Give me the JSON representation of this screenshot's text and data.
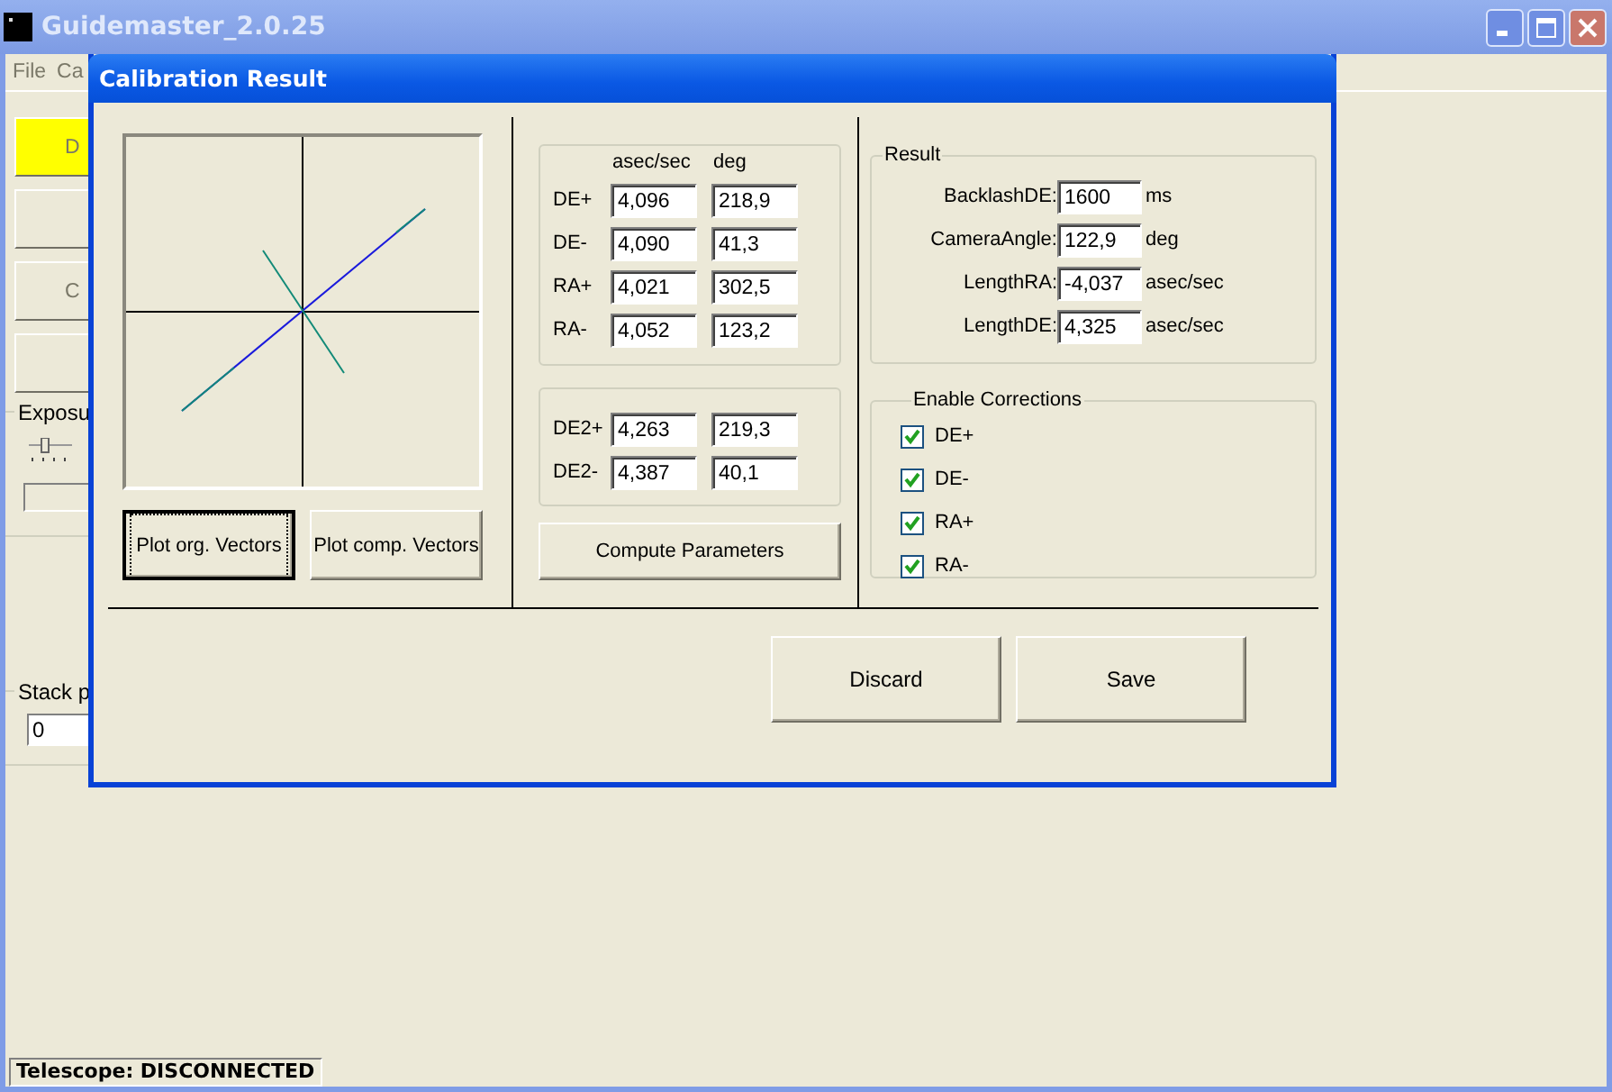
{
  "app_window": {
    "title": "Guidemaster_2.0.25",
    "menu": [
      "File",
      "Ca"
    ],
    "side_buttons": [
      {
        "label": "D",
        "highlighted": true
      },
      {
        "highlighted": false
      },
      {
        "label": "C",
        "highlighted": false
      },
      {
        "highlighted": false
      }
    ],
    "exposure_group": {
      "title": "Exposu"
    },
    "stack_group": {
      "title": "Stack p",
      "value": "0"
    },
    "status_bar": "Telescope: DISCONNECTED"
  },
  "dialog": {
    "title": "Calibration Result",
    "plot_buttons": [
      {
        "label": "Plot org. Vectors",
        "default": true
      },
      {
        "label": "Plot comp. Vectors",
        "default": false
      }
    ],
    "vectors": {
      "columns": [
        "asec/sec",
        "deg"
      ],
      "rows": [
        {
          "label": "DE+",
          "speed": "4,096",
          "angle": "218,9"
        },
        {
          "label": "DE-",
          "speed": "4,090",
          "angle": "41,3"
        },
        {
          "label": "RA+",
          "speed": "4,021",
          "angle": "302,5"
        },
        {
          "label": "RA-",
          "speed": "4,052",
          "angle": "123,2"
        }
      ]
    },
    "vectors2": [
      {
        "label": "DE2+",
        "speed": "4,263",
        "angle": "219,3"
      },
      {
        "label": "DE2-",
        "speed": "4,387",
        "angle": "40,1"
      }
    ],
    "compute_button": "Compute Parameters",
    "result": {
      "title": "Result",
      "fields": [
        {
          "label": "BacklashDE:",
          "value": "1600",
          "unit": "ms"
        },
        {
          "label": "CameraAngle:",
          "value": "122,9",
          "unit": "deg"
        },
        {
          "label": "LengthRA:",
          "value": "-4,037",
          "unit": "asec/sec"
        },
        {
          "label": "LengthDE:",
          "value": "4,325",
          "unit": "asec/sec"
        }
      ]
    },
    "corrections": {
      "title": "Enable Corrections",
      "items": [
        {
          "label": "DE+",
          "checked": true
        },
        {
          "label": "DE-",
          "checked": true
        },
        {
          "label": "RA+",
          "checked": true
        },
        {
          "label": "RA-",
          "checked": true
        }
      ]
    },
    "buttons": [
      "Discard",
      "Save"
    ]
  }
}
